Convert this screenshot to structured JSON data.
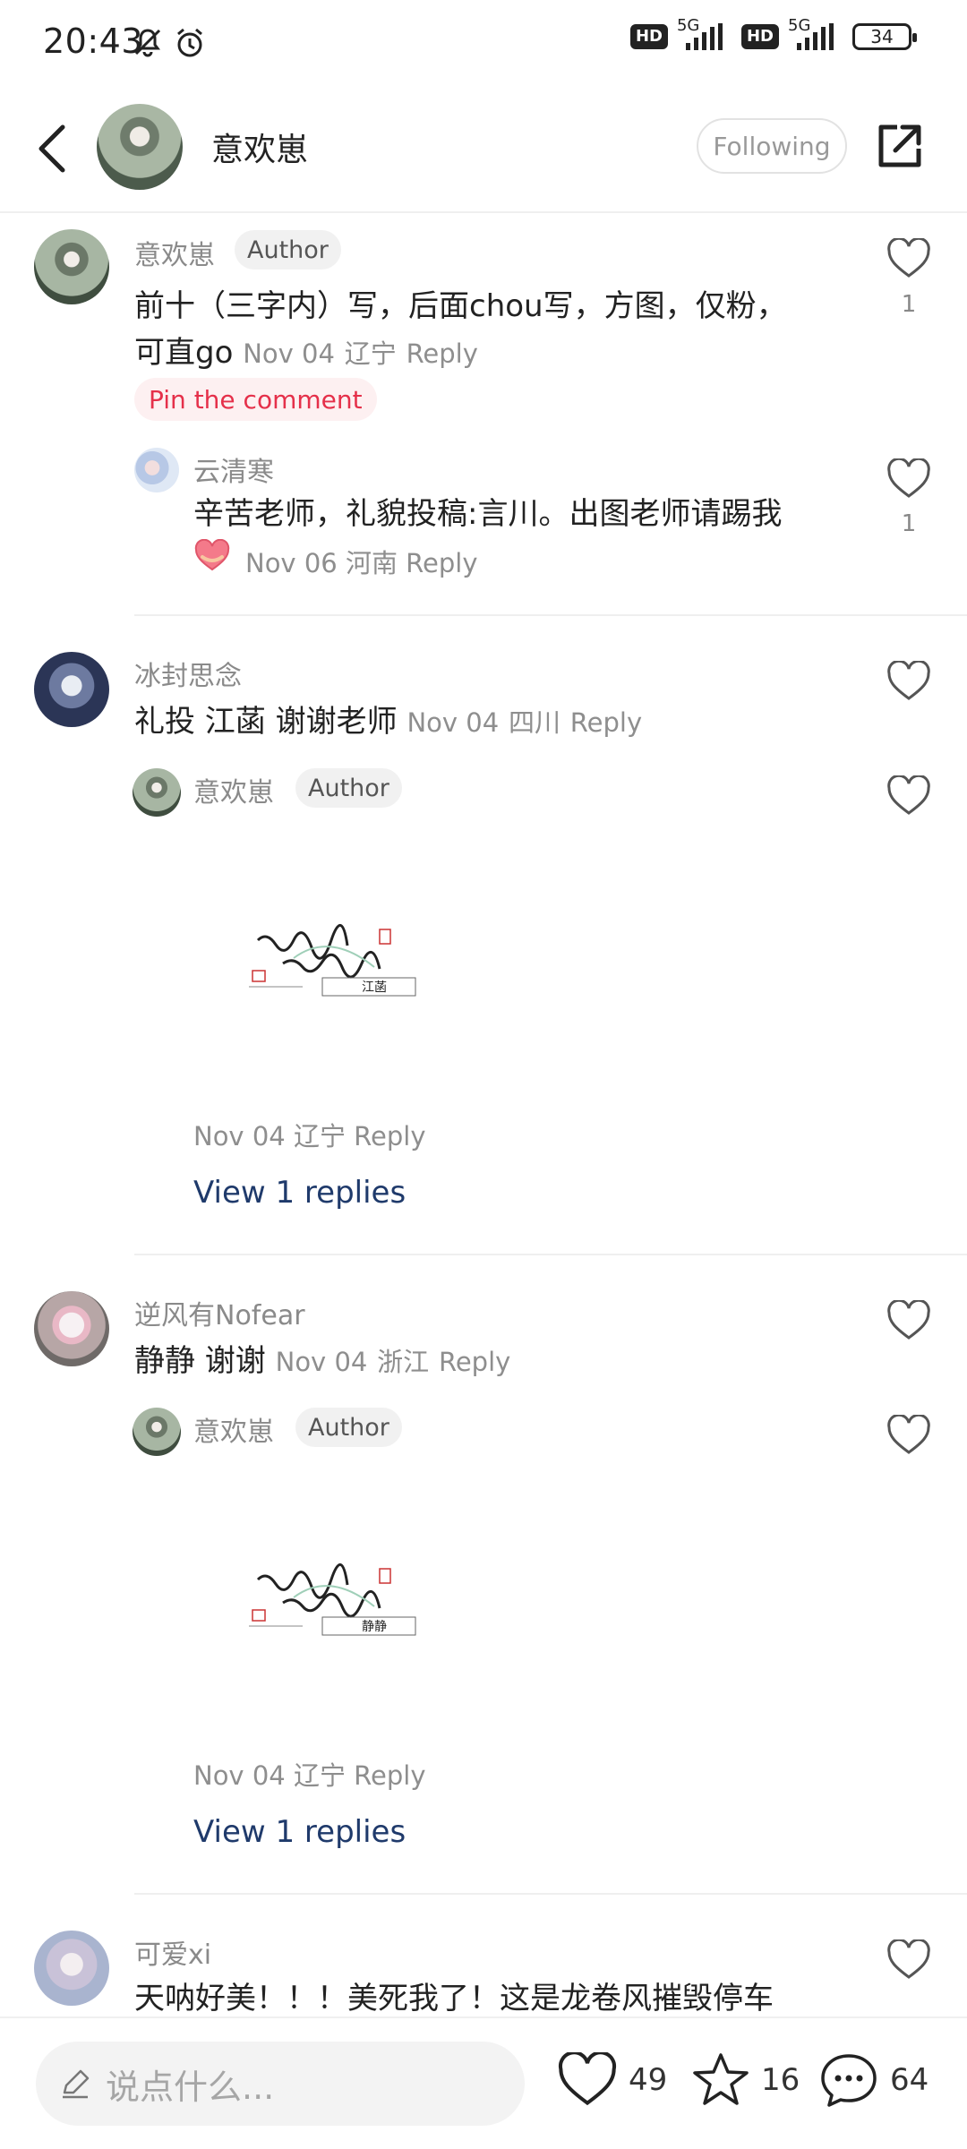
{
  "status_bar": {
    "time": "20:43",
    "network_1": "5G",
    "network_2": "5G",
    "hd_1": "HD",
    "hd_2": "HD",
    "battery": "34"
  },
  "header": {
    "username": "意欢崽",
    "follow_label": "Following"
  },
  "comments": [
    {
      "username": "意欢崽",
      "author_tag": "Author",
      "text_line1": "前十（三字内）写，后面chou写，方图，仅粉，",
      "text_line2": "可直go",
      "date": "Nov 04",
      "location": "辽宁",
      "reply_label": "Reply",
      "pin_label": "Pin the comment",
      "likes": "1",
      "reply": {
        "username": "云清寒",
        "text": "辛苦老师，礼貌投稿:言川。出图老师请踢我",
        "date": "Nov 06",
        "location": "河南",
        "reply_label": "Reply",
        "likes": "1"
      }
    },
    {
      "username": "冰封思念",
      "text": "礼投 江菡 谢谢老师",
      "date": "Nov 04",
      "location": "四川",
      "reply_label": "Reply",
      "reply": {
        "username": "意欢崽",
        "author_tag": "Author",
        "image_signature": "江菡",
        "date": "Nov 04",
        "location": "辽宁",
        "reply_label": "Reply"
      },
      "view_replies": "View 1 replies"
    },
    {
      "username": "逆风有Nofear",
      "text": "静静 谢谢",
      "date": "Nov 04",
      "location": "浙江",
      "reply_label": "Reply",
      "reply": {
        "username": "意欢崽",
        "author_tag": "Author",
        "image_signature": "静静",
        "date": "Nov 04",
        "location": "辽宁",
        "reply_label": "Reply"
      },
      "view_replies": "View 1 replies"
    },
    {
      "username": "可爱xi",
      "text": "天呐好美！！！美死我了！这是龙卷风摧毁停车"
    }
  ],
  "bottom_bar": {
    "input_placeholder": "说点什么...",
    "like_count": "49",
    "star_count": "16",
    "comment_count": "64"
  }
}
